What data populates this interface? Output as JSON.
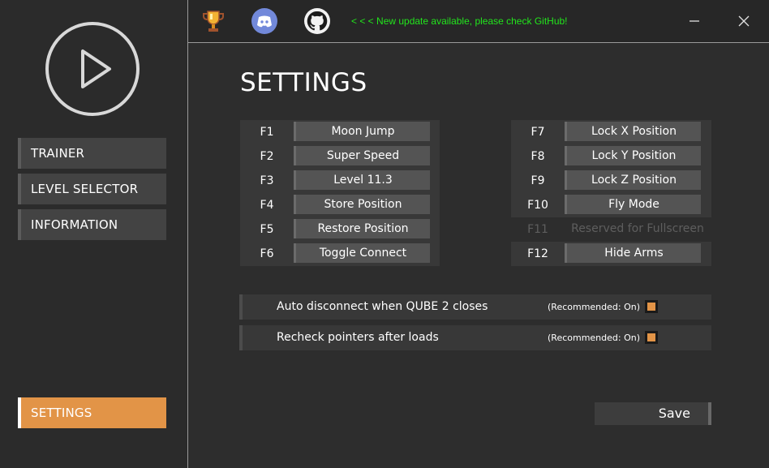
{
  "sidebar": {
    "nav": [
      {
        "label": "TRAINER"
      },
      {
        "label": "LEVEL SELECTOR"
      },
      {
        "label": "INFORMATION"
      }
    ],
    "settings_label": "SETTINGS"
  },
  "topbar": {
    "update_text": "< < < New update available, please check GitHub!",
    "icons": [
      "trophy-icon",
      "discord-icon",
      "github-icon"
    ]
  },
  "main": {
    "title": "SETTINGS",
    "left_keys": [
      {
        "key": "F1",
        "action": "Moon Jump"
      },
      {
        "key": "F2",
        "action": "Super Speed"
      },
      {
        "key": "F3",
        "action": "Level 11.3"
      },
      {
        "key": "F4",
        "action": "Store Position"
      },
      {
        "key": "F5",
        "action": "Restore Position"
      },
      {
        "key": "F6",
        "action": "Toggle Connect"
      }
    ],
    "right_keys": [
      {
        "key": "F7",
        "action": "Lock X Position"
      },
      {
        "key": "F8",
        "action": "Lock Y Position"
      },
      {
        "key": "F9",
        "action": "Lock Z Position"
      },
      {
        "key": "F10",
        "action": "Fly Mode"
      },
      {
        "key": "F11",
        "action": "Reserved for Fullscreen"
      },
      {
        "key": "F12",
        "action": "Hide Arms"
      }
    ],
    "options": [
      {
        "label": "Auto disconnect when QUBE 2 closes",
        "hint": "(Recommended: On)",
        "checked": true
      },
      {
        "label": "Recheck pointers after loads",
        "hint": "(Recommended: On)",
        "checked": true
      }
    ],
    "save_label": "Save"
  },
  "colors": {
    "accent": "#e29447",
    "update_green": "#22e51c",
    "background": "#2d2d2d"
  }
}
